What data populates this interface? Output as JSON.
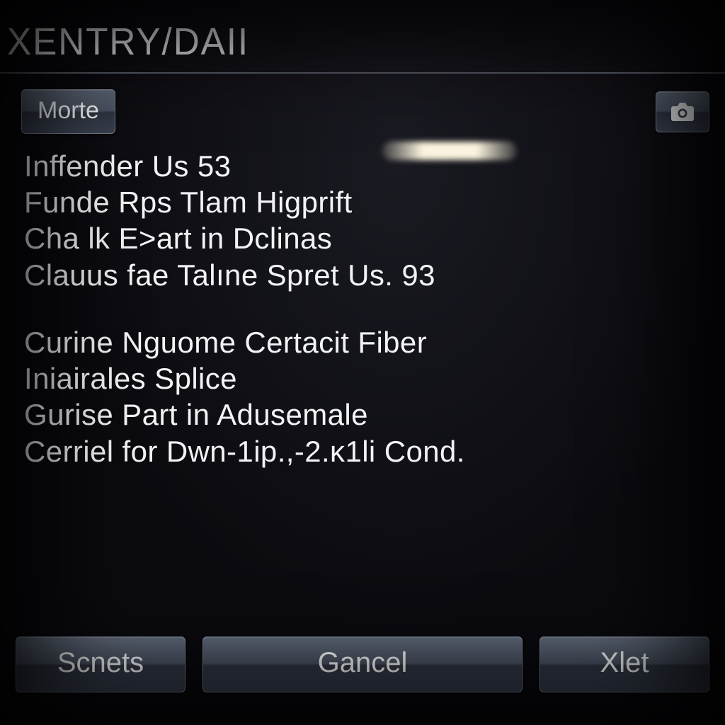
{
  "title": "XENTRY/DAII",
  "header": {
    "morte_label": "Morte",
    "camera_icon": "camera-icon"
  },
  "content": {
    "block1": [
      "Inffender Us 53",
      "Funde Rps Tlam Higprift",
      "Cha lk E>art in Dclinas",
      "Clauus fae Talıne Spret Us. 93"
    ],
    "block2": [
      "Curine Nguome Certacit Fiber",
      "Iniairales Splice",
      "Gurise Part in Adusemale",
      "Cerriel for Dwn-1ip.,-2.ĸ1li Cond."
    ]
  },
  "footer": {
    "left_label": "Scnets",
    "center_label": "Gancel",
    "right_label": "Xlet"
  }
}
